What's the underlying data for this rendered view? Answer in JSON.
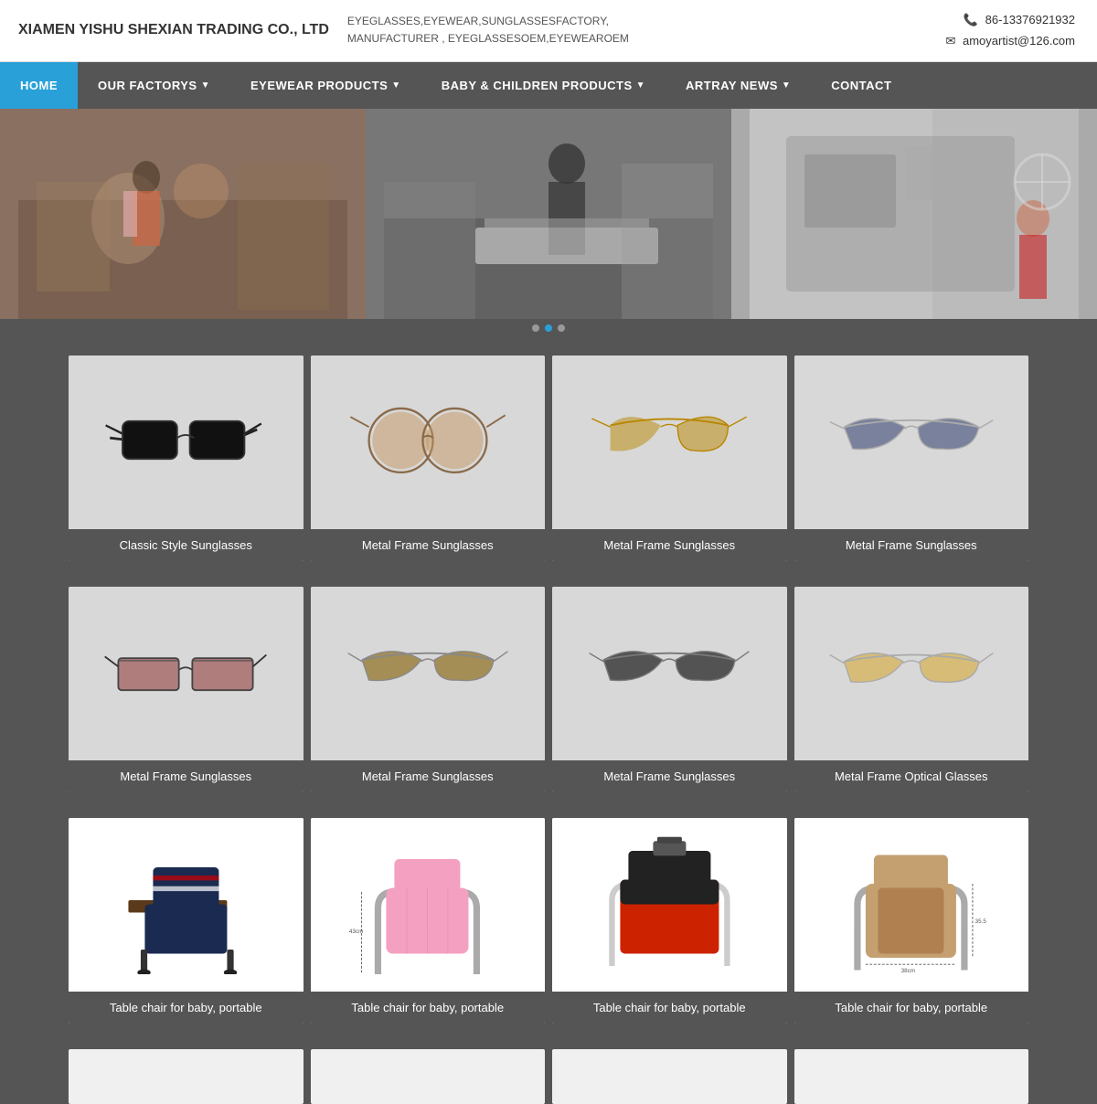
{
  "header": {
    "logo": "XIAMEN YISHU SHEXIAN TRADING CO., LTD",
    "tagline_line1": "EYEGLASSES,EYEWEAR,SUNGLASSESFACTORY,",
    "tagline_line2": "MANUFACTURER , EYEGLASSESOEM,EYEWEAROEM",
    "phone": "86-13376921932",
    "email": "amoyartist@126.com"
  },
  "nav": {
    "items": [
      {
        "label": "HOME",
        "active": true,
        "arrow": false
      },
      {
        "label": "OUR FACTORYS",
        "active": false,
        "arrow": true
      },
      {
        "label": "EYEWEAR PRODUCTS",
        "active": false,
        "arrow": true
      },
      {
        "label": "BABY & CHILDREN PRODUCTS",
        "active": false,
        "arrow": true
      },
      {
        "label": "ARTRAY NEWS",
        "active": false,
        "arrow": true
      },
      {
        "label": "CONTACT",
        "active": false,
        "arrow": false
      }
    ]
  },
  "products_row1": [
    {
      "label": "Classic Style Sunglasses",
      "type": "classic-black"
    },
    {
      "label": "Metal Frame Sunglasses",
      "type": "metal-round-brown"
    },
    {
      "label": "Metal Frame Sunglasses",
      "type": "metal-aviator-gold"
    },
    {
      "label": "Metal Frame Sunglasses",
      "type": "metal-aviator-navy"
    }
  ],
  "products_row2": [
    {
      "label": "Metal Frame Sunglasses",
      "type": "metal-rectangle-red"
    },
    {
      "label": "Metal Frame Sunglasses",
      "type": "metal-aviator-brown2"
    },
    {
      "label": "Metal Frame Sunglasses",
      "type": "metal-aviator-black"
    },
    {
      "label": "Metal Frame Optical Glasses",
      "type": "optical-yellow"
    }
  ],
  "products_row3": [
    {
      "label": "Table chair for baby, portable",
      "type": "baby-navy"
    },
    {
      "label": "Table chair for baby, portable",
      "type": "baby-pink"
    },
    {
      "label": "Table chair for baby, portable",
      "type": "baby-red"
    },
    {
      "label": "Table chair for baby, portable",
      "type": "baby-brown"
    }
  ]
}
